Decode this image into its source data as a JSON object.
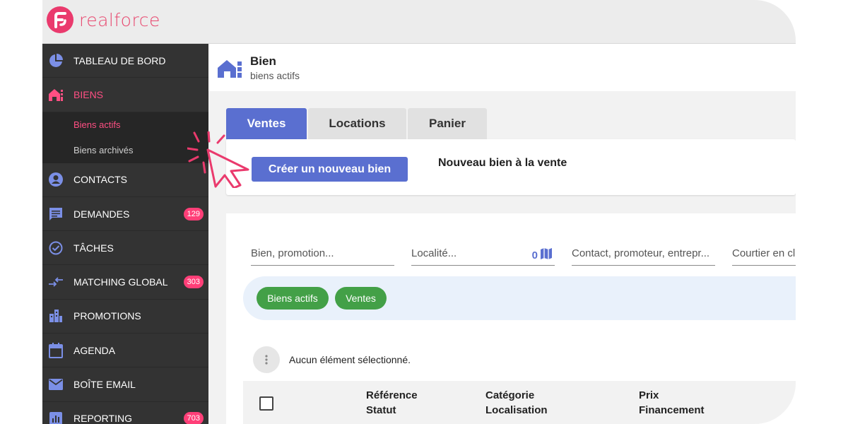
{
  "app": {
    "logo_text": "realforce",
    "brand_color": "#ea3a6d"
  },
  "sidebar": {
    "items": [
      {
        "label": "TABLEAU DE BORD",
        "icon": "pie-chart-icon"
      },
      {
        "label": "BIENS",
        "icon": "house-icon",
        "active": true,
        "subitems": [
          {
            "label": "Biens actifs",
            "active": true
          },
          {
            "label": "Biens archivés"
          }
        ]
      },
      {
        "label": "CONTACTS",
        "icon": "person-icon"
      },
      {
        "label": "DEMANDES",
        "icon": "message-icon",
        "badge": "129"
      },
      {
        "label": "TÂCHES",
        "icon": "check-circle-icon"
      },
      {
        "label": "MATCHING GLOBAL",
        "icon": "swap-arrows-icon",
        "badge": "303"
      },
      {
        "label": "PROMOTIONS",
        "icon": "buildings-icon"
      },
      {
        "label": "AGENDA",
        "icon": "calendar-icon"
      },
      {
        "label": "BOÎTE EMAIL",
        "icon": "mail-icon"
      },
      {
        "label": "REPORTING",
        "icon": "report-icon",
        "badge": "703"
      }
    ]
  },
  "header": {
    "title": "Bien",
    "subtitle": "biens actifs"
  },
  "tabs": [
    {
      "label": "Ventes",
      "active": true
    },
    {
      "label": "Locations"
    },
    {
      "label": "Panier"
    }
  ],
  "action_card": {
    "create_button": "Créer un nouveau bien",
    "label": "Nouveau bien à la vente"
  },
  "filters": {
    "bien_placeholder": "Bien, promotion...",
    "localite_placeholder": "Localité...",
    "map_count": "0",
    "contact_placeholder": "Contact, promoteur, entrepr...",
    "courtier_placeholder": "Courtier en cl"
  },
  "chips": [
    "Biens actifs",
    "Ventes"
  ],
  "selection": {
    "text": "Aucun élément sélectionné."
  },
  "table": {
    "columns": [
      {
        "line1": "Référence",
        "line2": "Statut"
      },
      {
        "line1": "Catégorie",
        "line2": "Localisation"
      },
      {
        "line1": "Prix",
        "line2": "Financement"
      }
    ]
  },
  "colors": {
    "sidebar_bg": "#333333",
    "active_pink": "#ff4f83",
    "primary_blue": "#5a6fd0",
    "chip_green": "#43a047"
  }
}
